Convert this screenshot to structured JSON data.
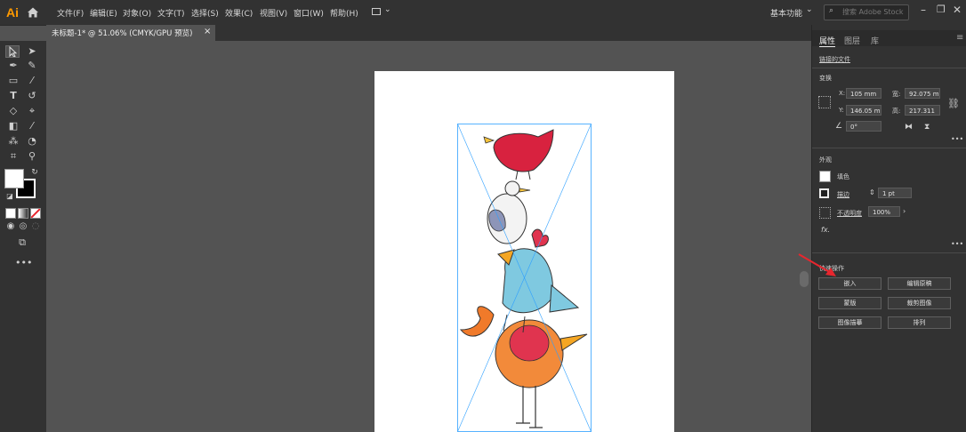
{
  "app": {
    "logo": "Ai"
  },
  "menu": [
    "文件(F)",
    "编辑(E)",
    "对象(O)",
    "文字(T)",
    "选择(S)",
    "效果(C)",
    "视图(V)",
    "窗口(W)",
    "帮助(H)"
  ],
  "workspace": {
    "label": "基本功能",
    "search_placeholder": "搜索 Adobe Stock"
  },
  "document_tab": {
    "title": "未标题-1* @ 51.06% (CMYK/GPU 预览)",
    "close": "×"
  },
  "panel": {
    "tabs": [
      "属性",
      "图层",
      "库"
    ],
    "linked_file": "链接的文件",
    "transform": {
      "header": "变换",
      "x_label": "X:",
      "x": "105 mm",
      "y_label": "Y:",
      "y": "146.05 m",
      "w_label": "宽:",
      "w": "92.075 m",
      "h_label": "高:",
      "h": "217.311",
      "angle": "0°"
    },
    "appearance": {
      "header": "外观",
      "fill": "填色",
      "stroke": "描边",
      "stroke_weight": "1 pt",
      "opacity_label": "不透明度",
      "opacity": "100%",
      "fx": "fx."
    },
    "quick_actions": {
      "header": "快速操作",
      "embed": "嵌入",
      "edit_original": "编辑原稿",
      "mask": "蒙版",
      "crop_image": "裁剪图像",
      "image_trace": "图像描摹",
      "arrange": "排列"
    }
  },
  "colors": {
    "accent": "#2ea0ff",
    "arrow": "#e8262e",
    "logo": "#ff9a00"
  }
}
